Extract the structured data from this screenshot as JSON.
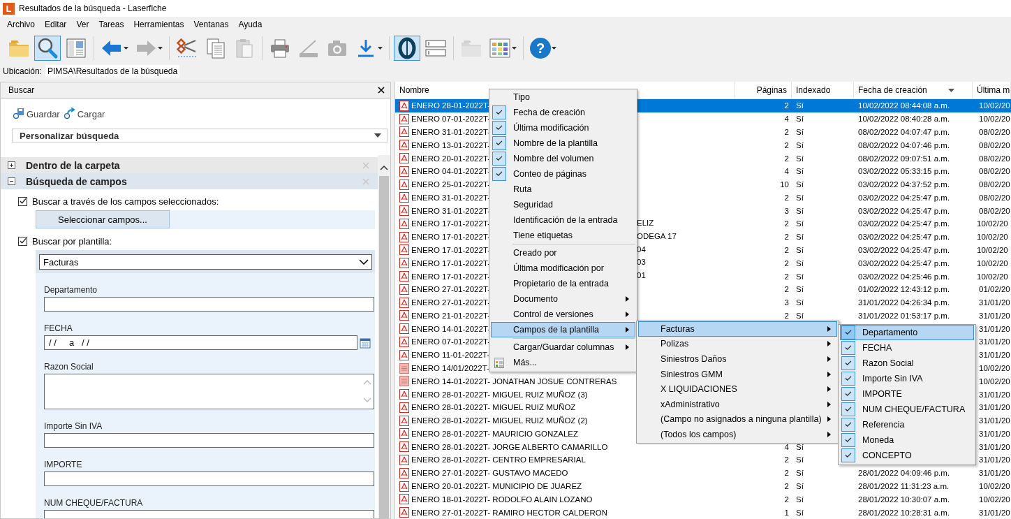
{
  "window": {
    "logo": "L",
    "title": "Resultados de la búsqueda - Laserfiche"
  },
  "menu_bar": [
    "Archivo",
    "Editar",
    "Ver",
    "Tareas",
    "Herramientas",
    "Ventanas",
    "Ayuda"
  ],
  "toolbar": [
    {
      "kind": "folder",
      "pressed": false,
      "disabled": false,
      "dropdown": false
    },
    {
      "kind": "search",
      "pressed": true,
      "disabled": false,
      "dropdown": false
    },
    {
      "kind": "panel",
      "pressed": false,
      "disabled": false,
      "dropdown": false
    },
    {
      "kind": "separator"
    },
    {
      "kind": "back",
      "pressed": false,
      "disabled": false,
      "dropdown": true
    },
    {
      "kind": "forward",
      "pressed": false,
      "disabled": true,
      "dropdown": true
    },
    {
      "kind": "separator"
    },
    {
      "kind": "cut",
      "pressed": false,
      "disabled": false,
      "dropdown": false
    },
    {
      "kind": "copy",
      "pressed": false,
      "disabled": false,
      "dropdown": false
    },
    {
      "kind": "paste",
      "pressed": false,
      "disabled": true,
      "dropdown": false
    },
    {
      "kind": "separator"
    },
    {
      "kind": "print",
      "pressed": false,
      "disabled": false,
      "dropdown": false
    },
    {
      "kind": "scan",
      "pressed": false,
      "disabled": true,
      "dropdown": false
    },
    {
      "kind": "camera",
      "pressed": false,
      "disabled": true,
      "dropdown": false
    },
    {
      "kind": "download",
      "pressed": false,
      "disabled": false,
      "dropdown": true
    },
    {
      "kind": "separator"
    },
    {
      "kind": "oval",
      "pressed": true,
      "disabled": false,
      "dropdown": false
    },
    {
      "kind": "fields",
      "pressed": false,
      "disabled": false,
      "dropdown": false
    },
    {
      "kind": "separator"
    },
    {
      "kind": "folder",
      "pressed": false,
      "disabled": true,
      "dropdown": false
    },
    {
      "kind": "grid",
      "pressed": false,
      "disabled": false,
      "dropdown": true
    },
    {
      "kind": "separator"
    },
    {
      "kind": "help",
      "glyph": "?",
      "pressed": false,
      "disabled": false,
      "dropdown": true
    }
  ],
  "location": {
    "label": "Ubicación:",
    "value": "PIMSA\\Resultados de la búsqueda"
  },
  "search_panel": {
    "title": "Buscar",
    "actions": [
      {
        "kind": "save",
        "label": "Guardar"
      },
      {
        "kind": "load",
        "label": "Cargar"
      }
    ],
    "preset": "Personalizar búsqueda",
    "sections": [
      {
        "title": "Dentro de la carpeta",
        "expanded": false
      },
      {
        "title": "Búsqueda de campos",
        "expanded": true
      }
    ],
    "options": [
      {
        "label": "Buscar a través de los campos seleccionados:",
        "checked": true,
        "button": "Seleccionar campos..."
      },
      {
        "label": "Buscar por plantilla:",
        "checked": true
      }
    ],
    "template": "Facturas",
    "fields": [
      {
        "label": "Departamento",
        "kind": "text"
      },
      {
        "label": "FECHA",
        "kind": "date",
        "value": "/ /     a   / /"
      },
      {
        "label": "Razon Social",
        "kind": "multiline"
      },
      {
        "label": "Importe Sin IVA",
        "kind": "text"
      },
      {
        "label": "IMPORTE",
        "kind": "text"
      },
      {
        "label": "NUM CHEQUE/FACTURA",
        "kind": "text"
      }
    ]
  },
  "results": {
    "columns": [
      {
        "label": "Nombre"
      },
      {
        "label": "Páginas"
      },
      {
        "label": "Indexado"
      },
      {
        "label": "Fecha de creación",
        "sorted": true
      },
      {
        "label": "Última m"
      }
    ],
    "rows": [
      {
        "kind": "pdf",
        "name": "ENERO 28-01-2022T-",
        "pages": "2",
        "indexed": "Sí",
        "created": "10/02/2022 08:44:08 a.m.",
        "modified": "10/02/20",
        "selected": true
      },
      {
        "kind": "pdf",
        "name": "ENERO 07-01-2022T-",
        "pages": "4",
        "indexed": "Sí",
        "created": "10/02/2022 08:40:28 a.m.",
        "modified": "10/02/20",
        "selected": false
      },
      {
        "kind": "pdf",
        "name": "ENERO 31-01-2022T-",
        "pages": "2",
        "indexed": "Sí",
        "created": "08/02/2022 04:07:47 p.m.",
        "modified": "08/02/20",
        "selected": false
      },
      {
        "kind": "pdf",
        "name": "ENERO 13-01-2022T-",
        "pages": "2",
        "indexed": "Sí",
        "created": "08/02/2022 04:07:46 p.m.",
        "modified": "08/02/20",
        "selected": false
      },
      {
        "kind": "pdf",
        "name": "ENERO 20-01-2022T-",
        "pages": "2",
        "indexed": "Sí",
        "created": "08/02/2022 09:07:51 a.m.",
        "modified": "08/02/20",
        "selected": false
      },
      {
        "kind": "pdf",
        "name": "ENERO 04-01-2022T-",
        "pages": "4",
        "indexed": "Sí",
        "created": "03/02/2022 05:33:15 p.m.",
        "modified": "08/02/20",
        "selected": false
      },
      {
        "kind": "pdf",
        "name": "ENERO 25-01-2022T-",
        "pages": "10",
        "indexed": "Sí",
        "created": "03/02/2022 04:37:52 p.m.",
        "modified": "08/02/20",
        "selected": false
      },
      {
        "kind": "pdf",
        "name": "ENERO 31-01-2022T-",
        "pages": "2",
        "indexed": "Sí",
        "created": "03/02/2022 04:25:47 p.m.",
        "modified": "08/02/20",
        "selected": false
      },
      {
        "kind": "pdf",
        "name": "ENERO 31-01-2022T-",
        "pages": "3",
        "indexed": "Sí",
        "created": "03/02/2022 04:25:47 p.m.",
        "modified": "08/02/20",
        "selected": false
      },
      {
        "kind": "pdf",
        "name": "ENERO 17-01-2022T-",
        "name_tail": "ELIZ",
        "pages": "2",
        "indexed": "Sí",
        "created": "03/02/2022 04:25:47 p.m.",
        "modified": "10/02/20",
        "selected": false
      },
      {
        "kind": "pdf",
        "name": "ENERO 17-01-2022T-",
        "name_tail": "ODEGA 17",
        "pages": "2",
        "indexed": "Sí",
        "created": "03/02/2022 04:25:47 p.m.",
        "modified": "10/02/20",
        "selected": false
      },
      {
        "kind": "pdf",
        "name": "ENERO 17-01-2022T-",
        "name_tail": "04",
        "pages": "2",
        "indexed": "Sí",
        "created": "03/02/2022 04:25:47 p.m.",
        "modified": "10/02/20",
        "selected": false
      },
      {
        "kind": "pdf",
        "name": "ENERO 17-01-2022T-",
        "name_tail": "03",
        "pages": "2",
        "indexed": "Sí",
        "created": "03/02/2022 04:25:47 p.m.",
        "modified": "10/02/20",
        "selected": false
      },
      {
        "kind": "pdf",
        "name": "ENERO 17-01-2022T-",
        "name_tail": "01",
        "pages": "2",
        "indexed": "Sí",
        "created": "03/02/2022 04:25:46 p.m.",
        "modified": "10/02/20",
        "selected": false
      },
      {
        "kind": "pdf",
        "name": "ENERO 27-01-2022T-",
        "pages": "2",
        "indexed": "Sí",
        "created": "01/02/2022 12:43:12 p.m.",
        "modified": "01/02/20",
        "selected": false
      },
      {
        "kind": "pdf",
        "name": "ENERO 27-01-2022T-",
        "pages": "3",
        "indexed": "Sí",
        "created": "31/01/2022 04:26:34 p.m.",
        "modified": "31/01/20",
        "selected": false
      },
      {
        "kind": "pdf",
        "name": "ENERO 21-01-2022T-",
        "pages": "2",
        "indexed": "Sí",
        "created": "31/01/2022 01:53:17 p.m.",
        "modified": "31/01/20",
        "selected": false
      },
      {
        "kind": "pdf",
        "name": "ENERO 14-01-2022T-",
        "modified": "31/01/20",
        "selected": false
      },
      {
        "kind": "pdf",
        "name": "ENERO 07-01-2022T-",
        "modified": "31/01/20",
        "selected": false
      },
      {
        "kind": "pdf",
        "name": "ENERO 11-01-2022T-",
        "modified": "31/01/20",
        "selected": false
      },
      {
        "kind": "doc",
        "name": "ENERO 14/01/2022T-",
        "modified": "10/02/20",
        "selected": false
      },
      {
        "kind": "doc",
        "name": "ENERO 14-01-2022T- JONATHAN JOSUE CONTRERAS",
        "modified": "10/02/20",
        "selected": false
      },
      {
        "kind": "pdf",
        "name": "ENERO 28-01-2022T- MIGUEL RUIZ MUÑOZ (3)",
        "modified": "31/01/20",
        "selected": false
      },
      {
        "kind": "pdf",
        "name": "ENERO 28-01-2022T- MIGUEL RUIZ MUÑOZ",
        "modified": "31/01/20",
        "selected": false
      },
      {
        "kind": "pdf",
        "name": "ENERO 28-01-2022T- MIGUEL RUIZ MUÑOZ (2)",
        "modified": "31/01/20",
        "selected": false
      },
      {
        "kind": "pdf",
        "name": "ENERO 28-01-2022T- MAURICIO GONZALEZ",
        "modified": "31/01/20",
        "selected": false
      },
      {
        "kind": "pdf",
        "name": "ENERO 28-01-2022T- JORGE ALBERTO CAMARILLO",
        "pages": "4",
        "indexed": "Sí",
        "modified": "31/01/20",
        "selected": false
      },
      {
        "kind": "pdf",
        "name": "ENERO 28-01-2022T- CENTRO EMPRESARIAL",
        "pages": "2",
        "indexed": "Sí",
        "modified": "31/01/20",
        "selected": false
      },
      {
        "kind": "pdf",
        "name": "ENERO 27-01-2022T- GUSTAVO MACEDO",
        "pages": "2",
        "indexed": "Sí",
        "created": "28/01/2022 04:09:46 p.m.",
        "modified": "31/01/20",
        "selected": false
      },
      {
        "kind": "pdf",
        "name": "ENERO 20-01-2022T- MUNICIPIO DE JUAREZ",
        "pages": "2",
        "indexed": "Sí",
        "created": "28/01/2022 11:31:23 a.m.",
        "modified": "10/02/20",
        "selected": false
      },
      {
        "kind": "pdf",
        "name": "ENERO 18-01-2022T- RODOLFO ALAIN LOZANO",
        "pages": "2",
        "indexed": "Sí",
        "created": "28/01/2022 10:30:07 a.m.",
        "modified": "10/02/20",
        "selected": false
      },
      {
        "kind": "pdf",
        "name": "ENERO 27-01-2022T- RAMIRO HECTOR CALDERON",
        "pages": "1",
        "indexed": "Sí",
        "created": "28/01/2022 10:28:31 a.m.",
        "modified": "31/01/20",
        "selected": false
      }
    ]
  },
  "context_menu": {
    "items": [
      {
        "kind": "item",
        "label": "Tipo",
        "checked": false,
        "submenu": false,
        "selected": false
      },
      {
        "kind": "item",
        "label": "Fecha de creación",
        "checked": true,
        "submenu": false,
        "selected": false
      },
      {
        "kind": "item",
        "label": "Última modificación",
        "checked": true,
        "submenu": false,
        "selected": false
      },
      {
        "kind": "item",
        "label": "Nombre de la plantilla",
        "checked": true,
        "submenu": false,
        "selected": false
      },
      {
        "kind": "item",
        "label": "Nombre del volumen",
        "checked": true,
        "submenu": false,
        "selected": false
      },
      {
        "kind": "item",
        "label": "Conteo de páginas",
        "checked": true,
        "submenu": false,
        "selected": false
      },
      {
        "kind": "item",
        "label": "Ruta",
        "checked": false,
        "submenu": false,
        "selected": false
      },
      {
        "kind": "item",
        "label": "Seguridad",
        "checked": false,
        "submenu": false,
        "selected": false
      },
      {
        "kind": "item",
        "label": "Identificación de la entrada",
        "checked": false,
        "submenu": false,
        "selected": false
      },
      {
        "kind": "item",
        "label": "Tiene etiquetas",
        "checked": false,
        "submenu": false,
        "selected": false
      },
      {
        "kind": "separator"
      },
      {
        "kind": "item",
        "label": "Creado por",
        "checked": false,
        "submenu": false,
        "selected": false
      },
      {
        "kind": "item",
        "label": "Última modificación por",
        "checked": false,
        "submenu": false,
        "selected": false
      },
      {
        "kind": "item",
        "label": "Propietario de la entrada",
        "checked": false,
        "submenu": false,
        "selected": false
      },
      {
        "kind": "item",
        "label": "Documento",
        "checked": false,
        "submenu": true,
        "selected": false
      },
      {
        "kind": "item",
        "label": "Control de versiones",
        "checked": false,
        "submenu": true,
        "selected": false
      },
      {
        "kind": "item",
        "label": "Campos de la plantilla",
        "checked": false,
        "submenu": true,
        "selected": true
      },
      {
        "kind": "separator"
      },
      {
        "kind": "item",
        "label": "Cargar/Guardar columnas",
        "checked": false,
        "submenu": true,
        "selected": false
      },
      {
        "kind": "icon-item",
        "label": "Más...",
        "checked": false,
        "submenu": false,
        "selected": false
      }
    ]
  },
  "template_submenu": {
    "items": [
      {
        "label": "Facturas",
        "submenu": true,
        "selected": true
      },
      {
        "label": "Polizas",
        "submenu": true,
        "selected": false
      },
      {
        "label": "Siniestros Daños",
        "submenu": true,
        "selected": false
      },
      {
        "label": "Siniestros GMM",
        "submenu": true,
        "selected": false
      },
      {
        "label": "X LIQUIDACIONES",
        "submenu": true,
        "selected": false
      },
      {
        "label": "xAdministrativo",
        "submenu": true,
        "selected": false
      },
      {
        "label": "(Campo no asignados a ninguna plantilla)",
        "submenu": true,
        "selected": false
      },
      {
        "label": "(Todos los campos)",
        "submenu": true,
        "selected": false
      }
    ]
  },
  "fields_submenu": {
    "items": [
      {
        "label": "Departamento",
        "checked": true,
        "submenu": false,
        "selected": true
      },
      {
        "label": "FECHA",
        "checked": true,
        "submenu": false,
        "selected": false
      },
      {
        "label": "Razon Social",
        "checked": true,
        "submenu": false,
        "selected": false
      },
      {
        "label": "Importe Sin IVA",
        "checked": true,
        "submenu": false,
        "selected": false
      },
      {
        "label": "IMPORTE",
        "checked": true,
        "submenu": false,
        "selected": false
      },
      {
        "label": "NUM CHEQUE/FACTURA",
        "checked": true,
        "submenu": false,
        "selected": false
      },
      {
        "label": "Referencia",
        "checked": true,
        "submenu": false,
        "selected": false
      },
      {
        "label": "Moneda",
        "checked": true,
        "submenu": false,
        "selected": false
      },
      {
        "label": "CONCEPTO",
        "checked": true,
        "submenu": false,
        "selected": false
      }
    ]
  }
}
